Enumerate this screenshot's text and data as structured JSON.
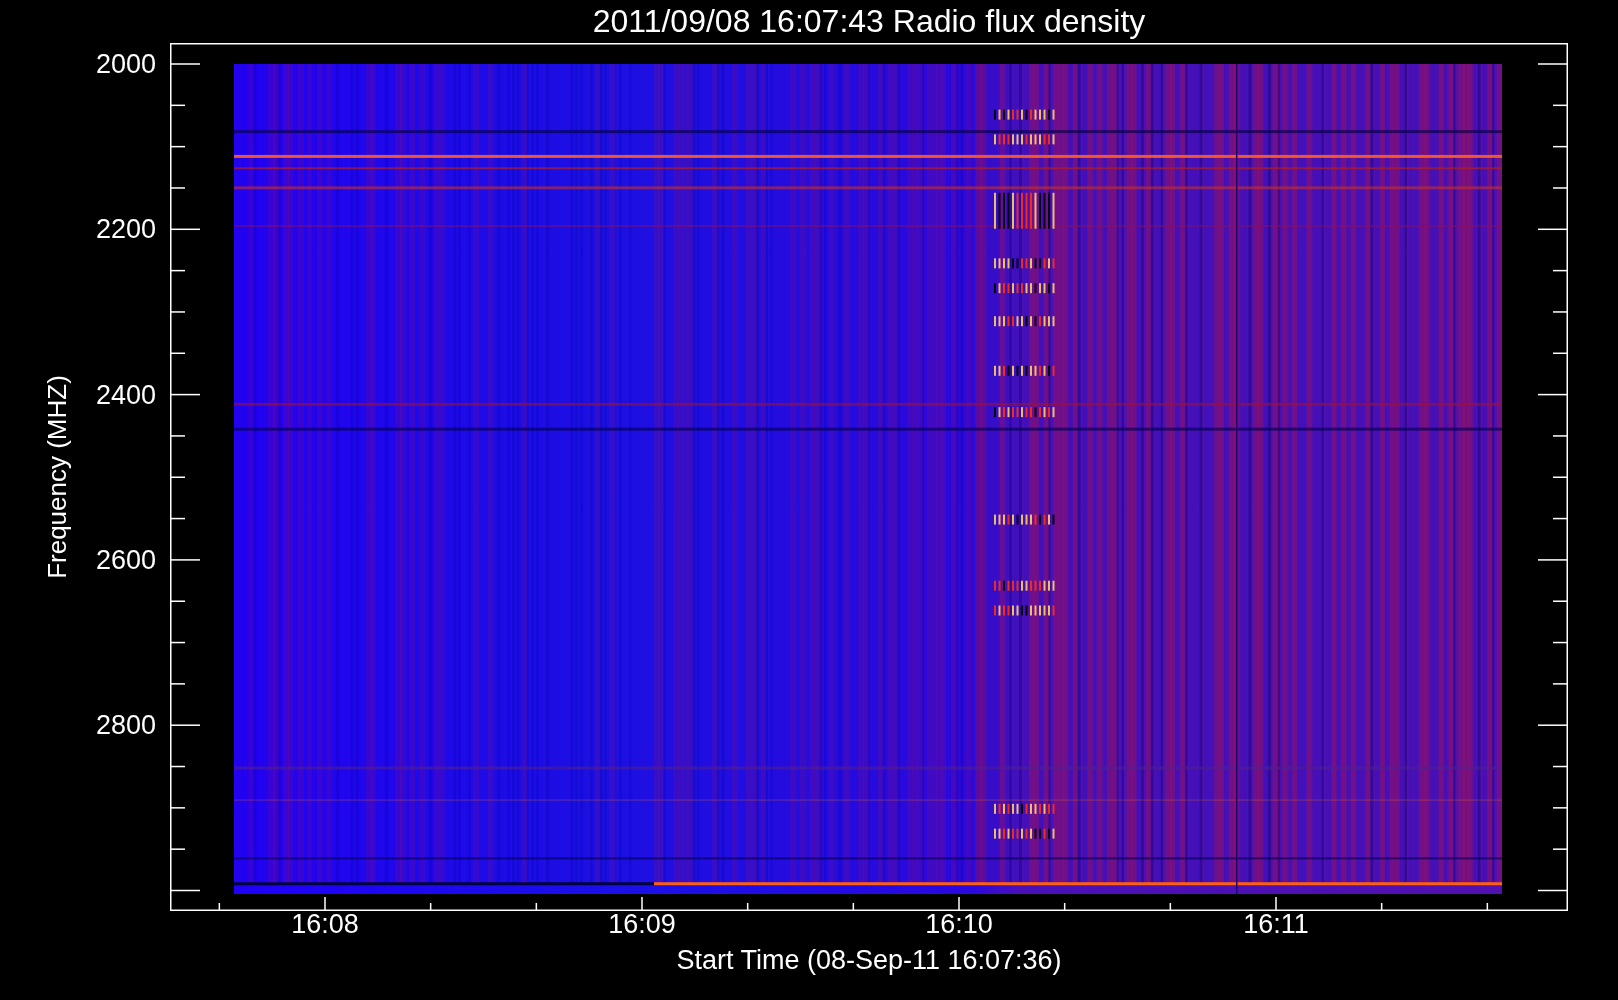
{
  "plot": {
    "title": "2011/09/08 16:07:43 Radio flux density",
    "ylabel": "Frequency (MHZ)",
    "xlabel": "Start Time (08-Sep-11 16:07:36)",
    "y_ticks": [
      "2000",
      "2200",
      "2400",
      "2600",
      "2800"
    ],
    "x_ticks": [
      "16:08",
      "16:09",
      "16:10",
      "16:11"
    ]
  }
}
